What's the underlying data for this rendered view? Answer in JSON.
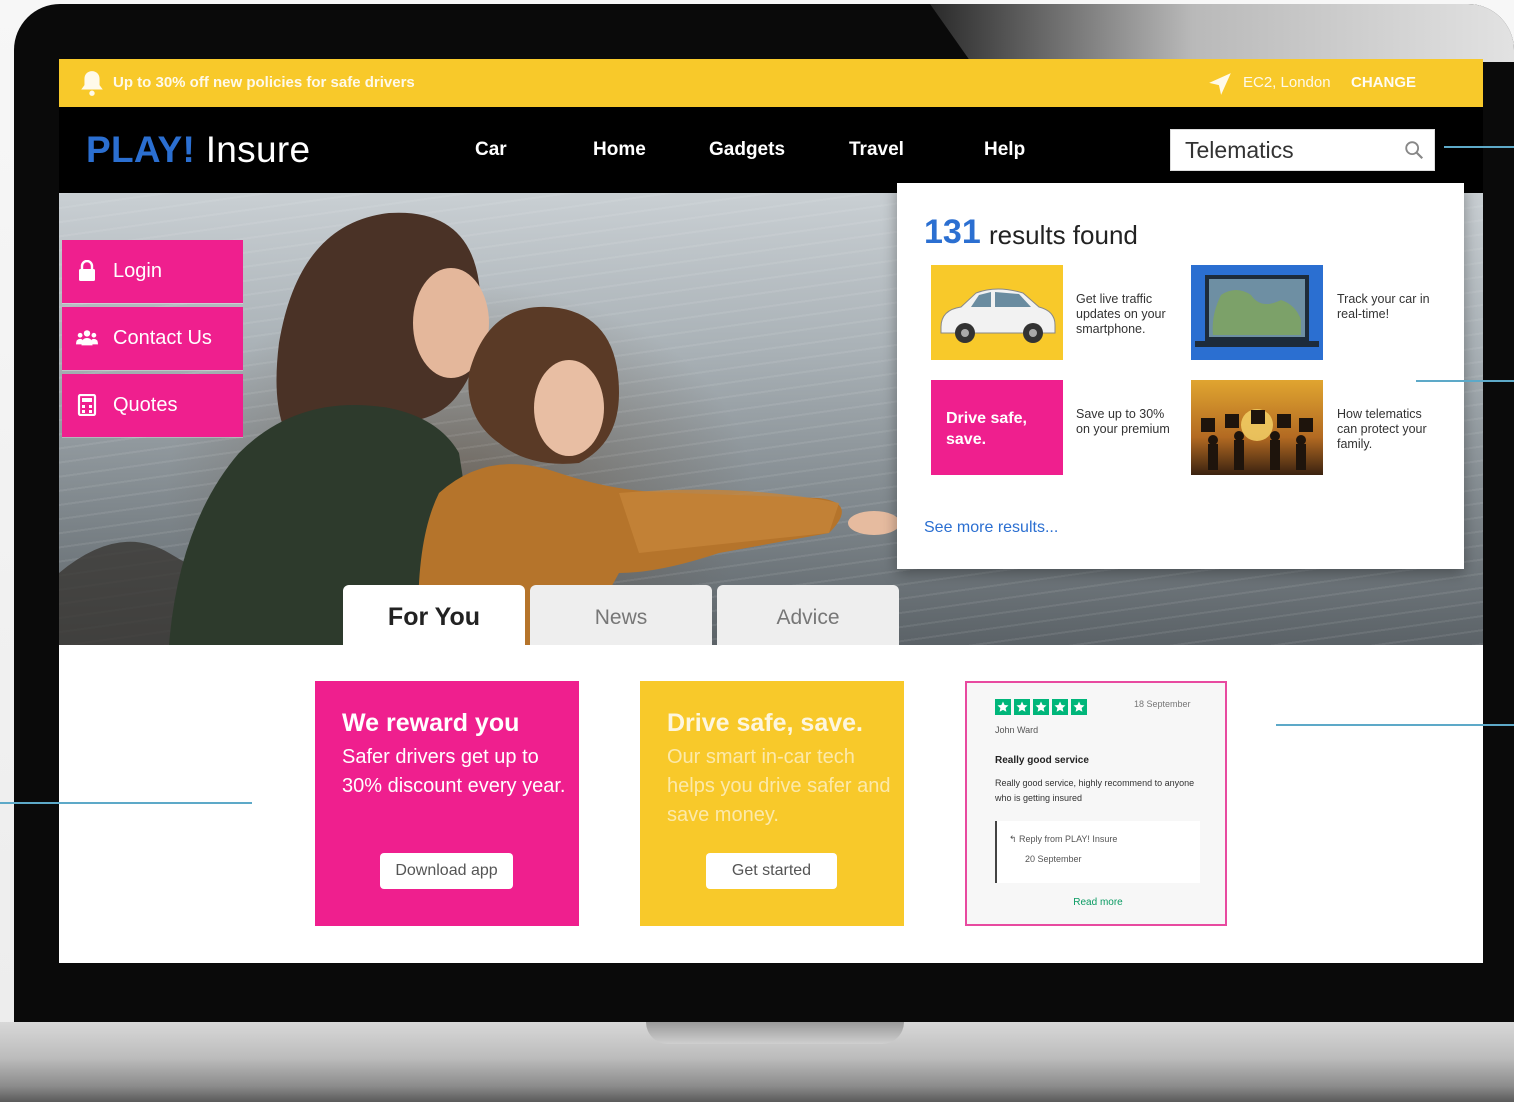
{
  "promo": {
    "text": "Up to 30% off new policies for safe drivers",
    "location": "EC2, London",
    "change_label": "CHANGE"
  },
  "header": {
    "logo_brand": "PLAY!",
    "logo_rest": " Insure",
    "nav": [
      "Car",
      "Home",
      "Gadgets",
      "Travel",
      "Help"
    ],
    "search_value": "Telematics"
  },
  "sidebar": {
    "buttons": [
      {
        "label": "Login",
        "icon": "lock-icon"
      },
      {
        "label": "Contact Us",
        "icon": "people-icon"
      },
      {
        "label": "Quotes",
        "icon": "calculator-icon"
      }
    ]
  },
  "search_results": {
    "count": "131",
    "label": "results found",
    "items": [
      {
        "thumb": "car-image",
        "text": "Get live traffic updates on your smartphone."
      },
      {
        "thumb": "map-laptop-image",
        "text": "Track your car in real-time!"
      },
      {
        "thumb": "drive-safe-tile",
        "thumb_text": "Drive safe, save.",
        "text": "Save up to 30% on your premium"
      },
      {
        "thumb": "family-sunset-image",
        "text": "How telematics can protect your family."
      }
    ],
    "see_more": "See more results..."
  },
  "tabs": [
    "For You",
    "News",
    "Advice"
  ],
  "cards": {
    "reward": {
      "title": "We reward you",
      "body": "Safer drivers get up to 30% discount every year.",
      "button": "Download app"
    },
    "drive": {
      "title": "Drive safe, save.",
      "body": "Our smart in-car tech helps you drive safer and save money.",
      "button": "Get started"
    },
    "review": {
      "rating": 5,
      "date": "18 September",
      "name": "John Ward",
      "title": "Really good service",
      "body": "Really good service, highly recommend to anyone who is getting insured",
      "reply_from": "Reply from PLAY! Insure",
      "reply_date": "20 September",
      "read_more": "Read more"
    }
  },
  "colors": {
    "yellow": "#f8c92a",
    "pink": "#ef1f8e",
    "blue": "#2b6fd1",
    "trustpilot_green": "#00b67a",
    "callout": "#5da9c8"
  }
}
